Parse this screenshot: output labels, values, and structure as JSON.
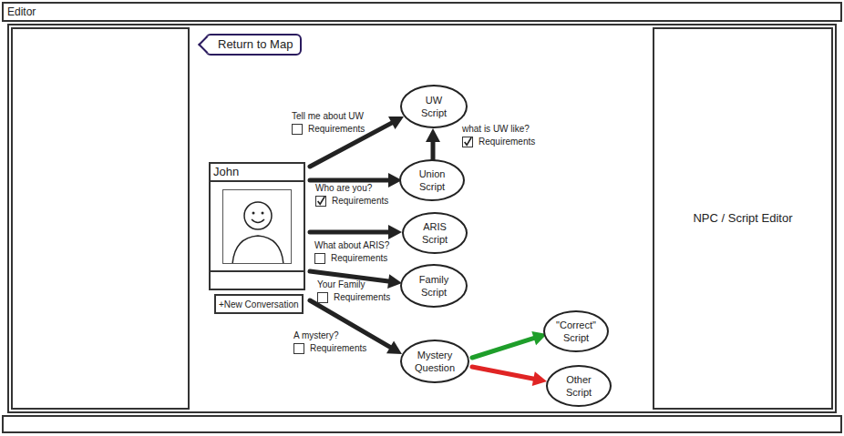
{
  "window": {
    "title": "Editor"
  },
  "back_button": "Return to Map",
  "npc": {
    "name": "John",
    "new_button": "+New Conversation"
  },
  "side_panel": {
    "title": "NPC / Script Editor"
  },
  "nodes": [
    "UW Script",
    "Union Script",
    "ARIS Script",
    "Family Script",
    "Mystery Question",
    "\"Correct\" Script",
    "Other Script"
  ],
  "links": [
    {
      "label": "Tell me about UW",
      "requirements": "Requirements",
      "checked": false
    },
    {
      "label": "what is UW like?",
      "requirements": "Requirements",
      "checked": true
    },
    {
      "label": "Who are you?",
      "requirements": "Requirements",
      "checked": true
    },
    {
      "label": "What about ARIS?",
      "requirements": "Requirements",
      "checked": false
    },
    {
      "label": "Your Family",
      "requirements": "Requirements",
      "checked": false
    },
    {
      "label": "A mystery?",
      "requirements": "Requirements",
      "checked": false
    }
  ],
  "branches": [
    {
      "color": "#1e9e2a"
    },
    {
      "color": "#e02424"
    }
  ]
}
